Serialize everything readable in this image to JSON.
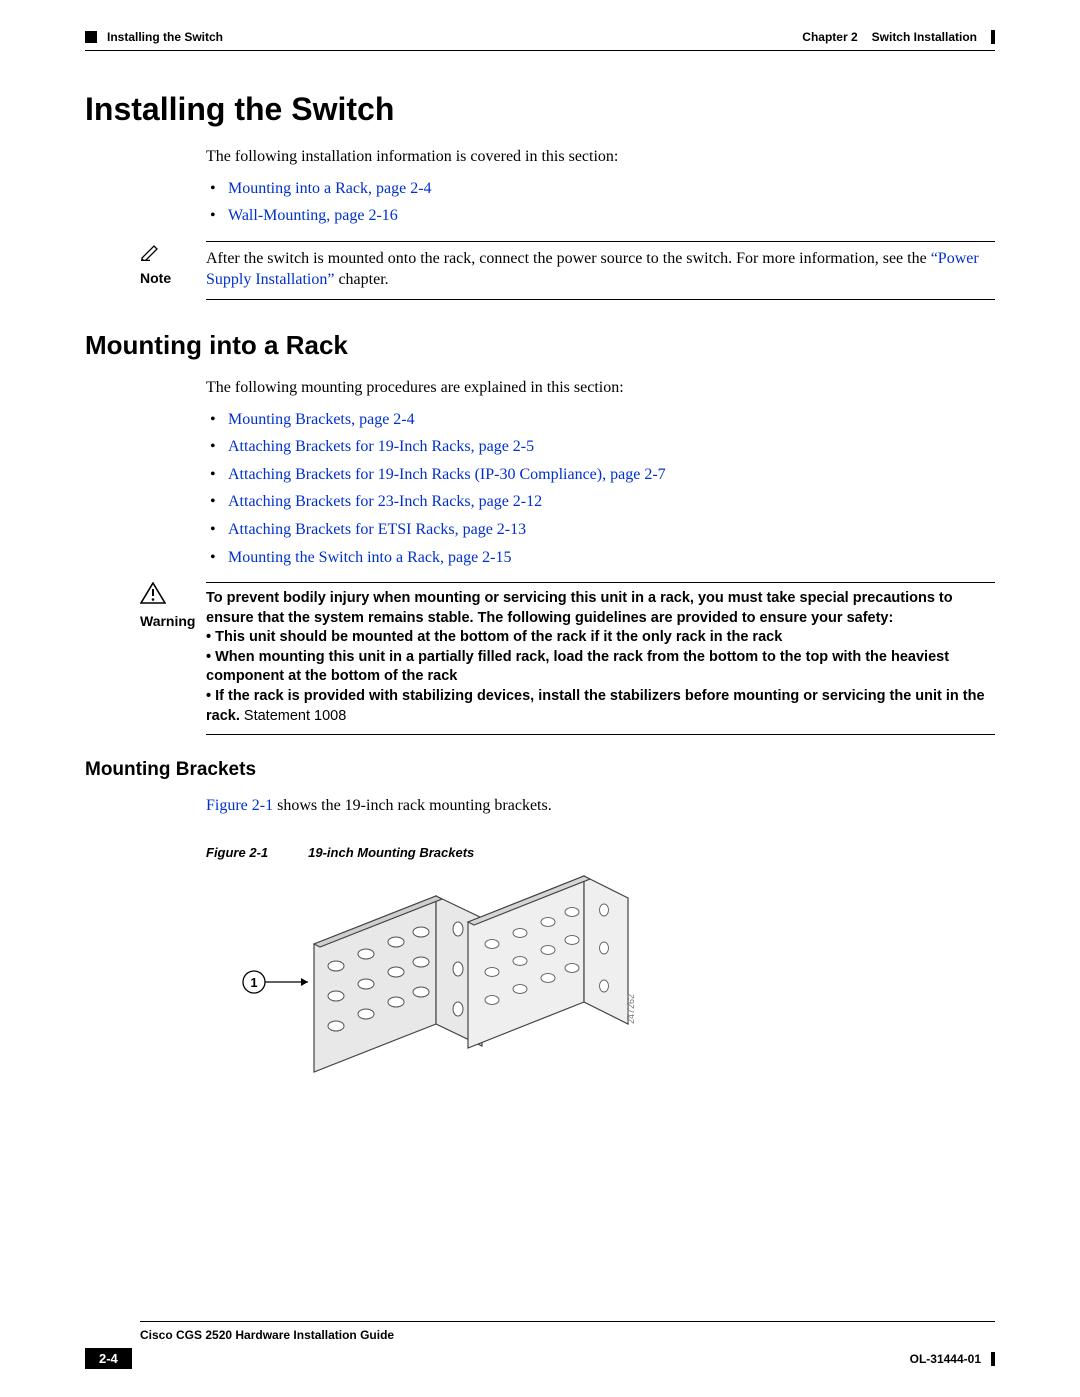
{
  "header": {
    "section_label": "Installing the Switch",
    "chapter_label": "Chapter 2",
    "chapter_title": "Switch Installation"
  },
  "h1": "Installing the Switch",
  "intro1": "The following installation information is covered in this section:",
  "links1": {
    "a": "Mounting into a Rack, page 2-4",
    "b": "Wall-Mounting, page 2-16"
  },
  "note": {
    "label": "Note",
    "text_before": "After the switch is mounted onto the rack, connect the power source to the switch. For more information, see the ",
    "quoted": "“Power Supply Installation”",
    "text_after": " chapter."
  },
  "h2": "Mounting into a Rack",
  "intro2": "The following mounting procedures are explained in this section:",
  "links2": {
    "a": "Mounting Brackets, page 2-4",
    "b": "Attaching Brackets for 19-Inch Racks, page 2-5",
    "c": "Attaching Brackets for 19-Inch Racks (IP-30 Compliance), page 2-7",
    "d": "Attaching Brackets for 23-Inch Racks, page 2-12",
    "e": "Attaching Brackets for ETSI Racks, page 2-13",
    "f": "Mounting the Switch into a Rack, page 2-15"
  },
  "warning": {
    "label": "Warning",
    "p1": "To prevent bodily injury when mounting or servicing this unit in a rack, you must take special precautions to ensure that the system remains stable. The following guidelines are provided to ensure your safety:",
    "b1": "• This unit should be mounted at the bottom of the rack if it the only rack in the rack",
    "b2": "• When mounting this unit in a partially filled rack, load the rack from the bottom to the top with the heaviest component at the bottom of the rack",
    "b3_a": "• If the rack is provided with stabilizing devices, install the stabilizers before mounting or servicing the unit in the rack.",
    "b3_stmt": " Statement 1008"
  },
  "h3": "Mounting Brackets",
  "fig_intro_link": "Figure 2-1",
  "fig_intro_rest": " shows the 19-inch rack mounting brackets.",
  "figcap": {
    "label": "Figure 2-1",
    "title": "19-inch Mounting Brackets"
  },
  "figure_callout": "1",
  "footer": {
    "guide": "Cisco CGS 2520 Hardware Installation Guide",
    "page": "2-4",
    "docnum": "OL-31444-01"
  }
}
